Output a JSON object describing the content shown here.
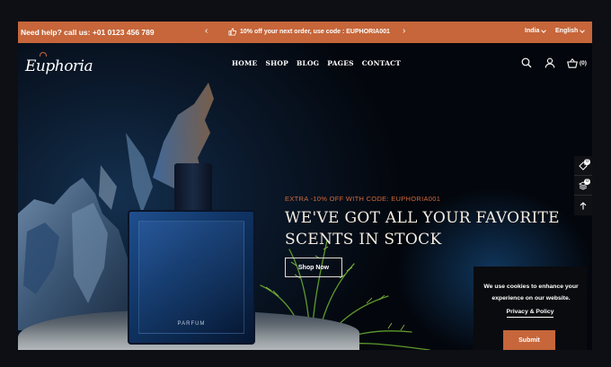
{
  "topbar": {
    "help_text": "Need help? call us: +01 0123 456 789",
    "promo_text": "10% off your next order, use code : EUPHORIA001",
    "prev_arrow": "‹",
    "next_arrow": "›",
    "country": "India",
    "language": "English"
  },
  "header": {
    "logo": "Euphoria",
    "nav": [
      "HOME",
      "SHOP",
      "BLOG",
      "PAGES",
      "CONTACT"
    ],
    "cart_count": "(0)"
  },
  "hero": {
    "extra_text": "EXTRA -10% OFF WITH CODE: EUPHORIA001",
    "headline_line1": "WE'VE GOT ALL YOUR FAVORITE",
    "headline_line2": "SCENTS IN STOCK",
    "cta_label": "Shop Now",
    "bottle_label": "PARFUM"
  },
  "sidetools": {
    "wishlist_count": "0",
    "compare_count": "0"
  },
  "cookie": {
    "message": "We use cookies to enhance your experience on our website.",
    "policy_link": "Privacy & Policy",
    "submit_label": "Submit"
  },
  "colors": {
    "accent": "#c6663a",
    "background": "#06070b"
  }
}
